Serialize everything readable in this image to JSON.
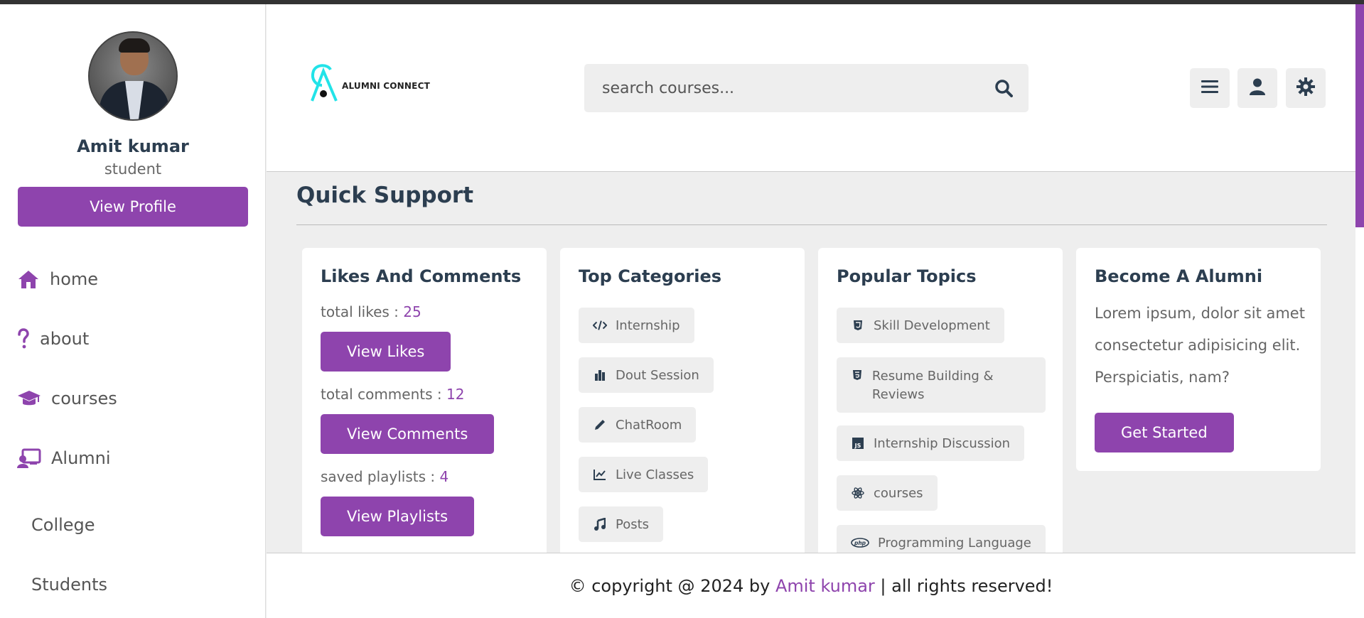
{
  "profile": {
    "name": "Amit kumar",
    "role": "student",
    "view_profile_label": "View Profile"
  },
  "nav": {
    "items": [
      {
        "label": "home",
        "icon": "home-icon"
      },
      {
        "label": "about",
        "icon": "question-icon"
      },
      {
        "label": "courses",
        "icon": "graduation-cap-icon"
      },
      {
        "label": "Alumni",
        "icon": "chalkboard-teacher-icon"
      }
    ],
    "sub_items": [
      {
        "label": "College"
      },
      {
        "label": "Students"
      }
    ]
  },
  "header": {
    "logo_text": "ALUMNI CONNECT",
    "search_placeholder": "search courses...",
    "buttons": [
      "menu-icon",
      "user-icon",
      "settings-icon"
    ]
  },
  "main": {
    "heading": "Quick Support",
    "likes_card": {
      "title": "Likes And Comments",
      "likes_label": "total likes : ",
      "likes_value": "25",
      "view_likes": "View Likes",
      "comments_label": "total comments : ",
      "comments_value": "12",
      "view_comments": "View Comments",
      "playlists_label": "saved playlists : ",
      "playlists_value": "4",
      "view_playlists": "View Playlists"
    },
    "categories_card": {
      "title": "Top Categories",
      "items": [
        {
          "label": "Internship",
          "icon": "code-icon"
        },
        {
          "label": "Dout Session",
          "icon": "bar-chart-icon"
        },
        {
          "label": "ChatRoom",
          "icon": "pen-icon"
        },
        {
          "label": "Live Classes",
          "icon": "line-chart-icon"
        },
        {
          "label": "Posts",
          "icon": "music-icon"
        }
      ]
    },
    "topics_card": {
      "title": "Popular Topics",
      "items": [
        {
          "label": "Skill Development",
          "icon": "html5-icon"
        },
        {
          "label": "Resume Building & Reviews",
          "icon": "css3-icon"
        },
        {
          "label": "Internship Discussion",
          "icon": "js-icon"
        },
        {
          "label": "courses",
          "icon": "react-icon"
        },
        {
          "label": "Programming Language",
          "icon": "php-icon"
        }
      ]
    },
    "alumni_card": {
      "title": "Become A Alumni",
      "text": "Lorem ipsum, dolor sit amet consectetur adipisicing elit. Perspiciatis, nam?",
      "button": "Get Started"
    }
  },
  "footer": {
    "prefix": "© copyright @ 2024 by ",
    "author": "Amit kumar",
    "suffix": " | all rights reserved!"
  },
  "colors": {
    "accent": "#8e44ad",
    "text_dark": "#2c3e50",
    "search_icon": "#2c3e50",
    "logo_cyan": "#22e3e8"
  }
}
